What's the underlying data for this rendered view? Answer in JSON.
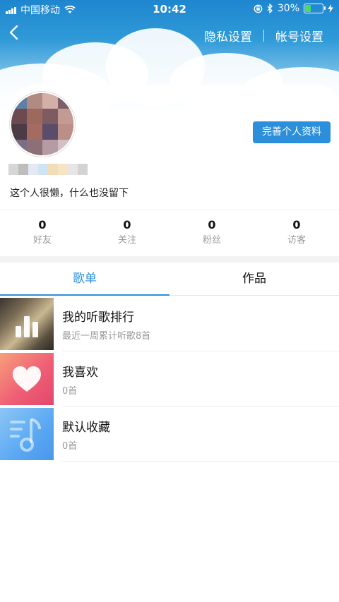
{
  "status": {
    "carrier": "中国移动",
    "time": "10:42",
    "battery_percent": "30%",
    "battery_level": 0.3
  },
  "nav": {
    "privacy_label": "隐私设置",
    "account_label": "帐号设置"
  },
  "profile": {
    "edit_label": "完善个人资料",
    "bio": "这个人很懒，什么也没留下"
  },
  "stats": [
    {
      "value": "0",
      "label": "好友"
    },
    {
      "value": "0",
      "label": "关注"
    },
    {
      "value": "0",
      "label": "粉丝"
    },
    {
      "value": "0",
      "label": "访客"
    }
  ],
  "tabs": [
    {
      "label": "歌单",
      "active": true
    },
    {
      "label": "作品",
      "active": false
    }
  ],
  "playlists": [
    {
      "title": "我的听歌排行",
      "subtitle": "最近一周累计听歌8首",
      "icon": "bar-chart-icon"
    },
    {
      "title": "我喜欢",
      "subtitle": "0首",
      "icon": "heart-icon"
    },
    {
      "title": "默认收藏",
      "subtitle": "0首",
      "icon": "music-note-icon"
    }
  ],
  "colors": {
    "accent": "#2b8fdc",
    "header_sky": "#1e86cf",
    "like_pink": "#ef5f76",
    "collection_blue": "#5aa8f2"
  }
}
